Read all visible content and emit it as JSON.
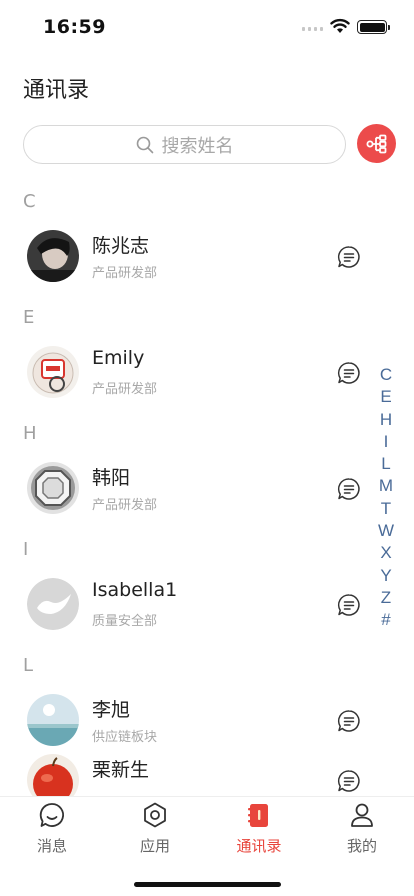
{
  "status_bar": {
    "time": "16:59"
  },
  "header": {
    "title": "通讯录"
  },
  "search": {
    "placeholder": "搜索姓名"
  },
  "sections": [
    {
      "letter": "C",
      "contacts": [
        {
          "name": "陈兆志",
          "dept": "产品研发部",
          "avatar": "avatar-portrait"
        }
      ]
    },
    {
      "letter": "E",
      "contacts": [
        {
          "name": "Emily",
          "dept": "产品研发部",
          "avatar": "avatar-sticker"
        }
      ]
    },
    {
      "letter": "H",
      "contacts": [
        {
          "name": "韩阳",
          "dept": "产品研发部",
          "avatar": "avatar-octagon"
        }
      ]
    },
    {
      "letter": "I",
      "contacts": [
        {
          "name": "Isabella1",
          "dept": "质量安全部",
          "avatar": "avatar-default"
        }
      ]
    },
    {
      "letter": "L",
      "contacts": [
        {
          "name": "李旭",
          "dept": "供应链板块",
          "avatar": "avatar-sea"
        },
        {
          "name": "栗新生",
          "dept": "",
          "avatar": "avatar-apple"
        }
      ]
    }
  ],
  "index_letters": [
    "C",
    "E",
    "H",
    "I",
    "L",
    "M",
    "T",
    "W",
    "X",
    "Y",
    "Z",
    "#"
  ],
  "tabs": [
    {
      "label": "消息",
      "icon": "message-icon"
    },
    {
      "label": "应用",
      "icon": "hexagon-icon"
    },
    {
      "label": "通讯录",
      "icon": "contacts-book-icon",
      "active": true
    },
    {
      "label": "我的",
      "icon": "person-icon"
    }
  ],
  "colors": {
    "accent": "#e8453c",
    "share_button": "#ec4b4b",
    "index_text": "#4a6b98"
  }
}
